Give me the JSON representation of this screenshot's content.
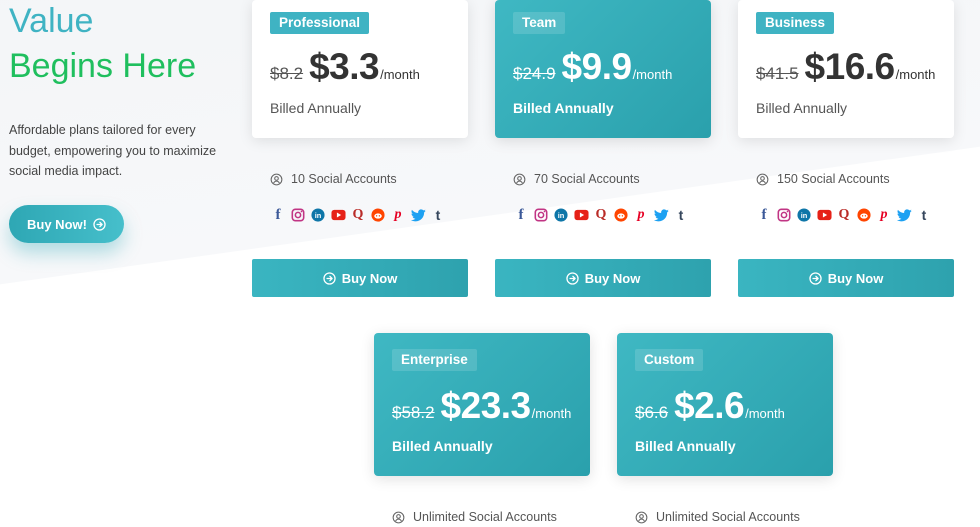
{
  "hero": {
    "title_line1": "Value",
    "title_line2": "Begins Here",
    "description": "Affordable plans tailored for every budget, empowering you to maximize social media impact.",
    "button_label": "Buy Now!"
  },
  "colors": {
    "teal": "#3fb3c3",
    "green": "#1fbf5e"
  },
  "plans": [
    {
      "name": "Professional",
      "old_price": "$8.2",
      "price": "$3.3",
      "per": "/month",
      "billing": "Billed Annually",
      "accounts": "10 Social Accounts",
      "buy_label": "Buy Now"
    },
    {
      "name": "Team",
      "old_price": "$24.9",
      "price": "$9.9",
      "per": "/month",
      "billing": "Billed Annually",
      "accounts": "70 Social Accounts",
      "buy_label": "Buy Now"
    },
    {
      "name": "Business",
      "old_price": "$41.5",
      "price": "$16.6",
      "per": "/month",
      "billing": "Billed Annually",
      "accounts": "150 Social Accounts",
      "buy_label": "Buy Now"
    },
    {
      "name": "Enterprise",
      "old_price": "$58.2",
      "price": "$23.3",
      "per": "/month",
      "billing": "Billed Annually",
      "accounts": "Unlimited Social Accounts"
    },
    {
      "name": "Custom",
      "old_price": "$6.6",
      "price": "$2.6",
      "per": "/month",
      "billing": "Billed Annually",
      "accounts": "Unlimited Social Accounts"
    }
  ],
  "social_icons": [
    "facebook-icon",
    "instagram-icon",
    "linkedin-icon",
    "youtube-icon",
    "quora-icon",
    "reddit-icon",
    "pinterest-icon",
    "twitter-icon",
    "tumblr-icon"
  ]
}
